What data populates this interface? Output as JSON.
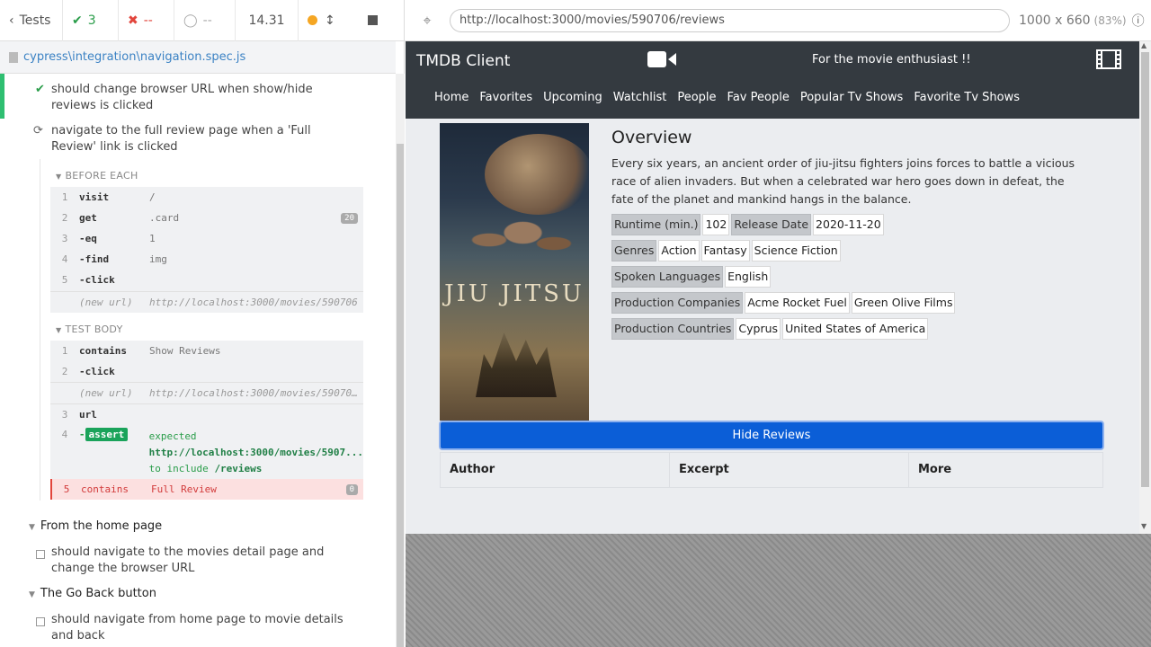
{
  "reporter": {
    "tests_label": "Tests",
    "passed_count": "3",
    "failed_count": "--",
    "pending_count": "--",
    "duration": "14.31",
    "spec_file": "cypress\\integration\\navigation.spec.js"
  },
  "tests": {
    "passed_title": "should change browser URL when show/hide reviews is clicked",
    "running_title": "navigate to the full review page when a 'Full Review' link is clicked",
    "before_each_label": "BEFORE EACH",
    "test_body_label": "TEST BODY",
    "before_each_cmds": [
      {
        "num": "1",
        "name": "visit",
        "msg": "/"
      },
      {
        "num": "2",
        "name": "get",
        "msg": ".card",
        "badge": "20"
      },
      {
        "num": "3",
        "name": "-eq",
        "msg": "1"
      },
      {
        "num": "4",
        "name": "-find",
        "msg": "img"
      },
      {
        "num": "5",
        "name": "-click",
        "msg": ""
      },
      {
        "num": "",
        "name": "(new url)",
        "msg": "http://localhost:3000/movies/590706"
      }
    ],
    "body_cmds": [
      {
        "num": "1",
        "name": "contains",
        "msg": "Show Reviews"
      },
      {
        "num": "2",
        "name": "-click",
        "msg": ""
      },
      {
        "num": "",
        "name": "(new url)",
        "msg": "http://localhost:3000/movies/59070..."
      },
      {
        "num": "3",
        "name": "url",
        "msg": ""
      }
    ],
    "assert_cmd": {
      "num": "4",
      "tag": "assert",
      "line1": "expected",
      "line2": "http://localhost:3000/movies/5907...",
      "line3a": "to include",
      "line3b": "/reviews"
    },
    "failed_cmd": {
      "num": "5",
      "name": "contains",
      "msg": "Full Review",
      "badge": "0"
    },
    "suite_home": "From the home page",
    "suite_home_test": "should navigate to the movies detail page and change the browser URL",
    "suite_back": "The Go Back button",
    "suite_back_test": "should navigate from home page to movie details and back"
  },
  "aut": {
    "url": "http://localhost:3000/movies/590706/reviews",
    "viewport": "1000 x 660",
    "scale": "(83%)"
  },
  "app": {
    "brand": "TMDB Client",
    "tagline": "For the movie enthusiast !!",
    "nav": [
      "Home",
      "Favorites",
      "Upcoming",
      "Watchlist",
      "People",
      "Fav People",
      "Popular Tv Shows",
      "Favorite Tv Shows"
    ],
    "poster_title": "JIU JITSU",
    "overview_heading": "Overview",
    "overview_text": "Every six years, an ancient order of jiu-jitsu fighters joins forces to battle a vicious race of alien invaders. But when a celebrated war hero goes down in defeat, the fate of the planet and mankind hangs in the balance.",
    "runtime_label": "Runtime (min.)",
    "runtime": "102",
    "release_label": "Release Date",
    "release_date": "2020-11-20",
    "genres_label": "Genres",
    "genres": [
      "Action",
      "Fantasy",
      "Science Fiction"
    ],
    "languages_label": "Spoken Languages",
    "languages": [
      "English"
    ],
    "companies_label": "Production Companies",
    "companies": [
      "Acme Rocket Fuel",
      "Green Olive Films"
    ],
    "countries_label": "Production Countries",
    "countries": [
      "Cyprus",
      "United States of America"
    ],
    "hide_reviews": "Hide Reviews",
    "table_headers": [
      "Author",
      "Excerpt",
      "More"
    ]
  },
  "colors": {
    "navbar": "#343a40",
    "button": "#0b5ed7",
    "pass": "#2a9d4a",
    "fail": "#e2453c"
  }
}
